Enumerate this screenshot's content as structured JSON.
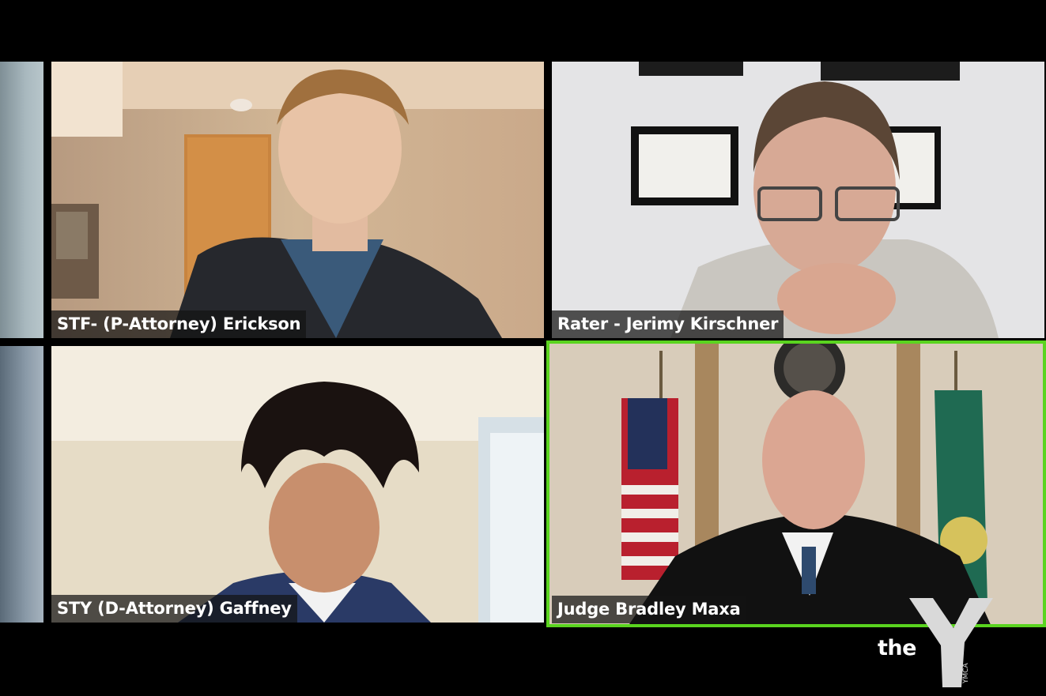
{
  "meeting": {
    "gallery": {
      "participants": [
        {
          "name": "STF- (P-Attorney) Erickson",
          "active_speaker": false
        },
        {
          "name": "Rater - Jerimy Kirschner",
          "active_speaker": false
        },
        {
          "name": "STY (D-Attorney) Gaffney",
          "active_speaker": false
        },
        {
          "name": "Judge Bradley Maxa",
          "active_speaker": true
        }
      ]
    },
    "active_speaker_color": "#5ad41f"
  },
  "watermark": {
    "brand_text": "the",
    "logo_letter": "Y",
    "logo_subtext": "YMCA"
  }
}
